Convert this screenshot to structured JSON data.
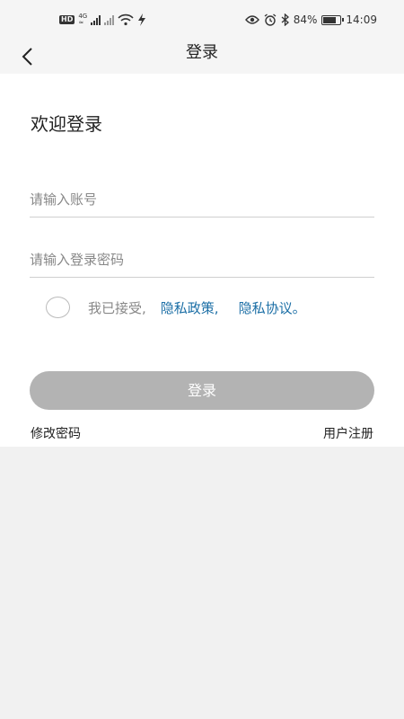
{
  "status_bar": {
    "hd": "HD",
    "net_top": "4G",
    "net_bottom": "≈",
    "battery_percent": "84%",
    "battery_level": 0.84,
    "time": "14:09"
  },
  "header": {
    "title": "登录"
  },
  "form": {
    "welcome": "欢迎登录",
    "account_placeholder": "请输入账号",
    "password_placeholder": "请输入登录密码",
    "agree_text": "我已接受,",
    "privacy_policy": "隐私政策,",
    "privacy_agreement": "隐私协议。",
    "login_label": "登录",
    "change_password": "修改密码",
    "register": "用户注册"
  },
  "colors": {
    "link": "#1c6fa6",
    "button_disabled": "#b3b3b3",
    "background": "#f1f1f1"
  }
}
